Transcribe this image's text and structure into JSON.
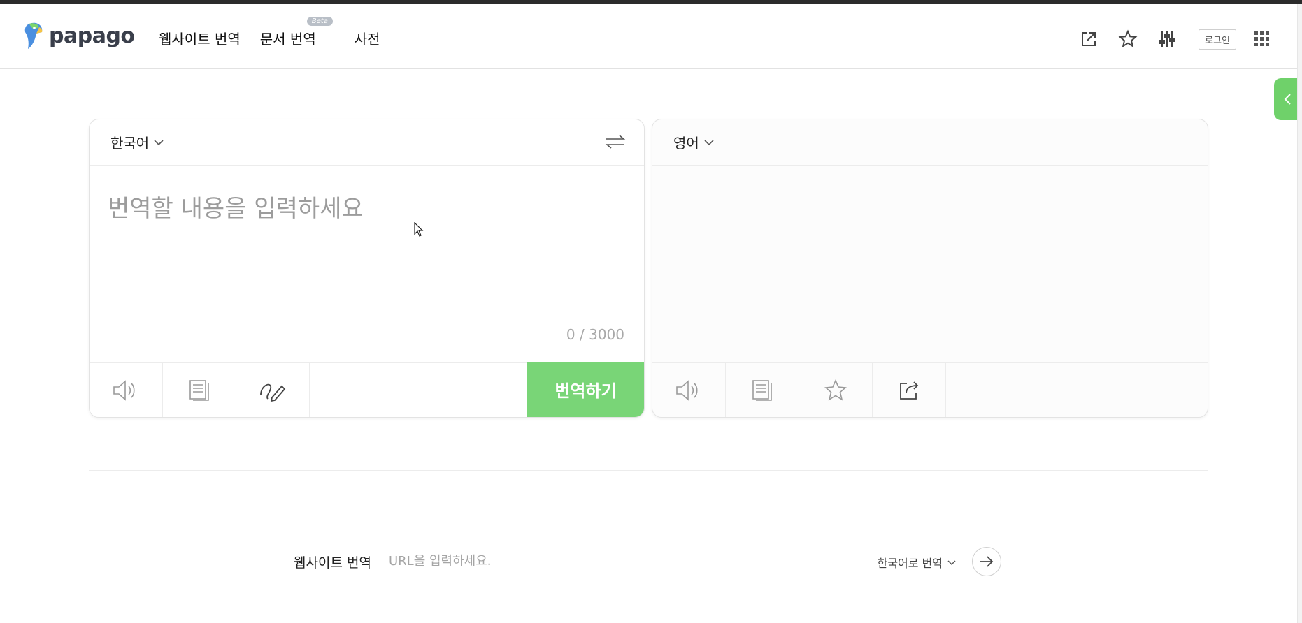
{
  "header": {
    "logo_text": "papago",
    "nav": [
      {
        "label": "웹사이트 번역"
      },
      {
        "label": "문서 번역",
        "badge": "Beta"
      },
      {
        "label": "사전"
      }
    ],
    "login_label": "로그인",
    "icons": [
      "new-window-icon",
      "star-icon",
      "settings-sliders-icon",
      "apps-grid-icon"
    ]
  },
  "source_panel": {
    "language": "한국어",
    "placeholder": "번역할 내용을 입력하세요",
    "counter": "0 / 3000",
    "translate_label": "번역하기",
    "footer_icons": [
      "speaker-icon",
      "copy-icon",
      "handwriting-icon"
    ]
  },
  "target_panel": {
    "language": "영어",
    "footer_icons": [
      "speaker-icon",
      "copy-icon",
      "star-icon",
      "share-icon"
    ]
  },
  "website_translate": {
    "label": "웹사이트 번역",
    "placeholder": "URL을 입력하세요.",
    "target_language": "한국어로 번역"
  },
  "colors": {
    "accent_green": "#79d577",
    "side_tab_green": "#6fd16a",
    "header_text": "#3a3f4b"
  }
}
